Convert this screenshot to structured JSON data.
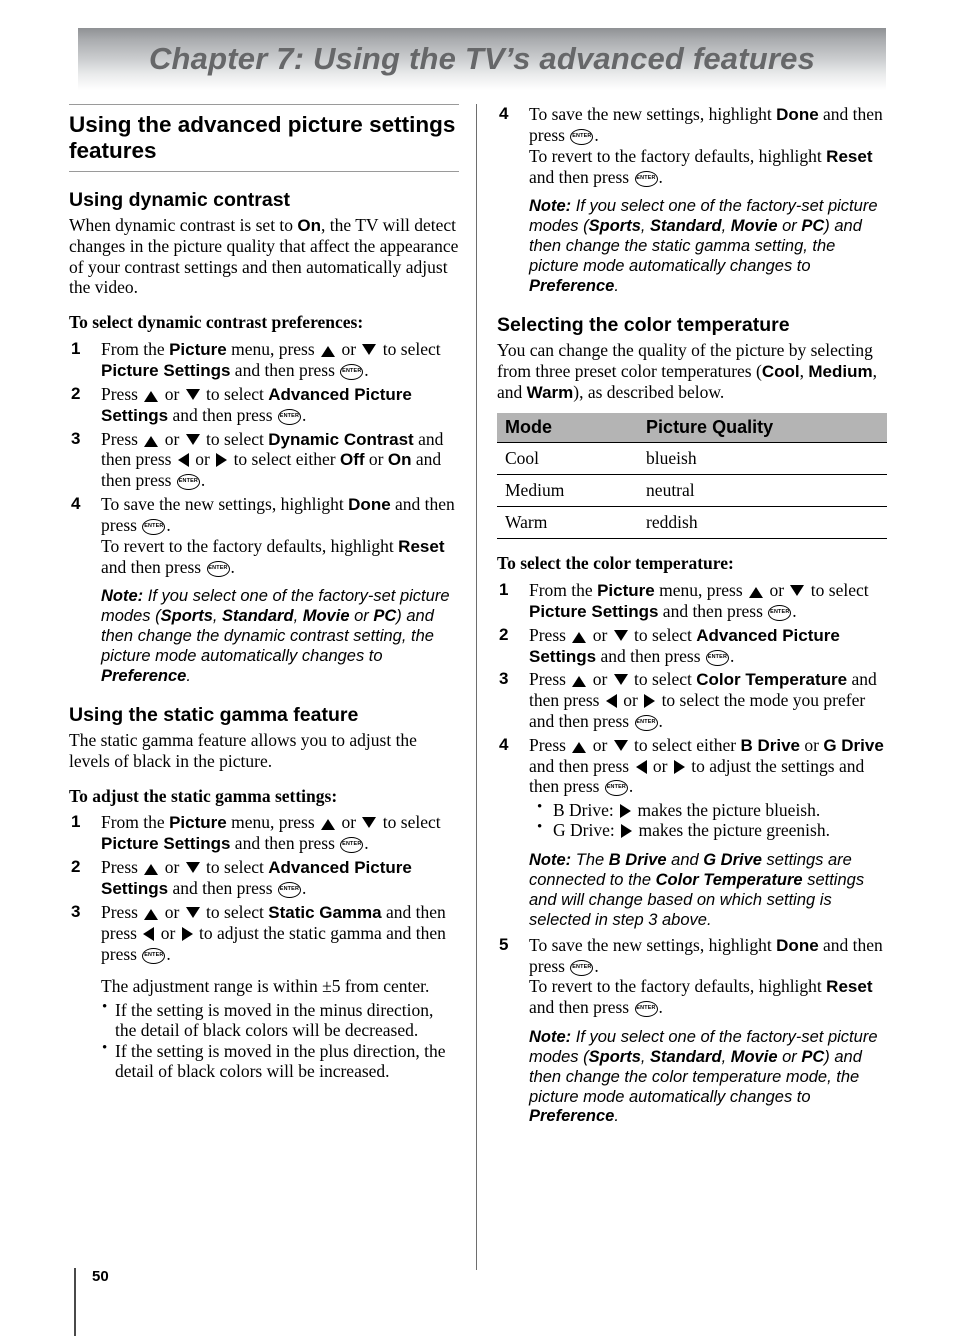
{
  "chapter": {
    "title": "Chapter 7: Using the TV’s advanced features",
    "band_color_top": "#8f9194",
    "band_color_bottom": "#ffffff",
    "title_color": "#666769"
  },
  "page": {
    "number": "50"
  },
  "icons": {
    "enter_label": "ENTER"
  },
  "left": {
    "section_heading": "Using the advanced picture settings features",
    "dynamic": {
      "heading": "Using dynamic contrast",
      "intro_1": "When dynamic contrast is set to ",
      "intro_on": "On",
      "intro_2": ", the TV will detect changes in the picture quality that affect the appearance of your contrast settings and then automatically adjust the video.",
      "lead_in": "To select dynamic contrast preferences:",
      "step1": {
        "num": "1",
        "t1": "From the ",
        "b1": "Picture",
        "t2": " menu, press ",
        "t3": " or ",
        "t4": " to select ",
        "b2": "Picture Settings",
        "t5": " and then press ",
        "t6": "."
      },
      "step2": {
        "num": "2",
        "t1": "Press ",
        "t2": " or ",
        "t3": " to select ",
        "b1": "Advanced Picture Settings",
        "t4": " and then press ",
        "t5": "."
      },
      "step3": {
        "num": "3",
        "t1": "Press ",
        "t2": " or ",
        "t3": " to select ",
        "b1": "Dynamic Contrast",
        "t4": " and then press ",
        "t5": " or ",
        "t6": " to select either ",
        "b2": "Off",
        "t7": " or ",
        "b3": "On",
        "t8": " and then press ",
        "t9": "."
      },
      "step4": {
        "num": "4",
        "t1": "To save the new settings, highlight ",
        "b1": "Done",
        "t2": " and then press ",
        "t3": ".",
        "t4": "To revert to the factory defaults, highlight ",
        "b2": "Reset",
        "t5": " and then press ",
        "t6": "."
      },
      "note": {
        "label": "Note:",
        "t1": " If you select one of the factory-set picture modes (",
        "b1": "Sports",
        "t2": ", ",
        "b2": "Standard",
        "t3": ", ",
        "b3": "Movie",
        "t4": " or ",
        "b4": "PC",
        "t5": ") and then change the dynamic contrast setting, the picture mode automatically changes to ",
        "b5": "Preference",
        "t6": "."
      }
    },
    "gamma": {
      "heading": "Using the static gamma feature",
      "intro": "The static gamma feature allows you to adjust the levels of black in the picture.",
      "lead_in": "To adjust the static gamma settings:",
      "step1": {
        "num": "1",
        "t1": "From the ",
        "b1": "Picture",
        "t2": " menu, press ",
        "t3": " or ",
        "t4": " to select ",
        "b2": "Picture Settings",
        "t5": " and then press ",
        "t6": "."
      },
      "step2": {
        "num": "2",
        "t1": "Press ",
        "t2": " or ",
        "t3": " to select ",
        "b1": "Advanced Picture Settings",
        "t4": " and then press ",
        "t5": "."
      },
      "step3": {
        "num": "3",
        "t1": "Press ",
        "t2": " or ",
        "t3": " to select ",
        "b1": "Static Gamma",
        "t4": " and then press ",
        "t5": " or ",
        "t6": " to adjust the static gamma and then press ",
        "t7": ".",
        "range": "The adjustment range is within ±5 from center.",
        "bullet1": "If the setting is moved in the minus direction, the detail of black colors will be decreased.",
        "bullet2": "If the setting is moved in the plus direction, the detail of black colors will be increased."
      }
    }
  },
  "right": {
    "gamma_step4": {
      "num": "4",
      "t1": "To save the new settings, highlight ",
      "b1": "Done",
      "t2": " and then press ",
      "t3": ".",
      "t4": "To revert to the factory defaults, highlight ",
      "b2": "Reset",
      "t5": " and then press ",
      "t6": "."
    },
    "gamma_note": {
      "label": "Note:",
      "t1": " If you select one of the factory-set picture modes (",
      "b1": "Sports",
      "t2": ", ",
      "b2": "Standard",
      "t3": ", ",
      "b3": "Movie",
      "t4": " or ",
      "b4": "PC",
      "t5": ") and then change the static gamma setting, the picture mode automatically changes to ",
      "b5": "Preference",
      "t6": "."
    },
    "color": {
      "heading": "Selecting the color temperature",
      "intro_1": "You can change the quality of the picture by selecting from three preset color temperatures (",
      "b1": "Cool",
      "intro_2": ", ",
      "b2": "Medium",
      "intro_3": ", and ",
      "b3": "Warm",
      "intro_4": "), as described below.",
      "table": {
        "headers": [
          "Mode",
          "Picture Quality"
        ],
        "rows": [
          [
            "Cool",
            "blueish"
          ],
          [
            "Medium",
            "neutral"
          ],
          [
            "Warm",
            "reddish"
          ]
        ],
        "header_bg": "#b4b4b4"
      },
      "lead_in": "To select the color temperature:",
      "step1": {
        "num": "1",
        "t1": "From the ",
        "b1": "Picture",
        "t2": " menu, press ",
        "t3": " or ",
        "t4": " to select ",
        "b2": "Picture Settings",
        "t5": " and then press ",
        "t6": "."
      },
      "step2": {
        "num": "2",
        "t1": "Press ",
        "t2": " or ",
        "t3": " to select ",
        "b1": "Advanced Picture Settings",
        "t4": " and then press ",
        "t5": "."
      },
      "step3": {
        "num": "3",
        "t1": "Press ",
        "t2": " or ",
        "t3": " to select ",
        "b1": "Color Temperature",
        "t4": " and then press ",
        "t5": " or ",
        "t6": " to select the mode you prefer and then press ",
        "t7": "."
      },
      "step4": {
        "num": "4",
        "t1": "Press ",
        "t2": " or ",
        "t3": " to select either ",
        "b1": "B Drive",
        "t4": " or ",
        "b2": "G Drive",
        "t5": " and then press ",
        "t6": " or ",
        "t7": " to adjust the settings and then press ",
        "t8": ".",
        "bullet1_a": "B Drive: ",
        "bullet1_b": " makes the picture blueish.",
        "bullet2_a": "G Drive: ",
        "bullet2_b": " makes the picture greenish."
      },
      "drive_note": {
        "label": "Note:",
        "t1": " The ",
        "b1": "B Drive",
        "t2": " and ",
        "b2": "G Drive",
        "t3": " settings are connected to the ",
        "b3": "Color Temperature",
        "t4": " settings and will change based on which setting is selected in step 3 above."
      },
      "step5": {
        "num": "5",
        "t1": "To save the new settings, highlight ",
        "b1": "Done",
        "t2": " and then press ",
        "t3": ".",
        "t4": "To revert to the factory defaults, highlight ",
        "b2": "Reset",
        "t5": " and then press ",
        "t6": "."
      },
      "final_note": {
        "label": "Note:",
        "t1": " If you select one of the factory-set picture modes (",
        "b1": "Sports",
        "t2": ", ",
        "b2": "Standard",
        "t3": ", ",
        "b3": "Movie",
        "t4": " or ",
        "b4": "PC",
        "t5": ") and then change the color temperature mode, the picture mode automatically changes to ",
        "b5": "Preference",
        "t6": "."
      }
    }
  }
}
